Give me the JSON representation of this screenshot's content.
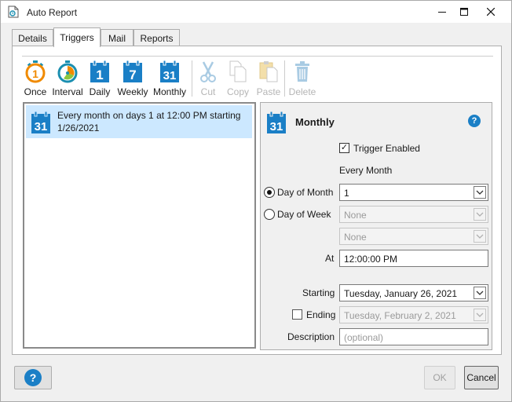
{
  "window": {
    "title": "Auto Report"
  },
  "tabs": [
    {
      "label": "Details"
    },
    {
      "label": "Triggers"
    },
    {
      "label": "Mail"
    },
    {
      "label": "Reports"
    }
  ],
  "toolbar": {
    "once": {
      "label": "Once",
      "icon": "stopwatch-once-icon",
      "icon_text": "1"
    },
    "interval": {
      "label": "Interval",
      "icon": "stopwatch-interval-icon"
    },
    "daily": {
      "label": "Daily",
      "icon": "calendar-daily-icon",
      "icon_text": "1"
    },
    "weekly": {
      "label": "Weekly",
      "icon": "calendar-weekly-icon",
      "icon_text": "7"
    },
    "monthly": {
      "label": "Monthly",
      "icon": "calendar-monthly-icon",
      "icon_text": "31"
    },
    "cut": {
      "label": "Cut",
      "icon": "scissors-icon"
    },
    "copy": {
      "label": "Copy",
      "icon": "copy-icon"
    },
    "paste": {
      "label": "Paste",
      "icon": "paste-icon"
    },
    "delete": {
      "label": "Delete",
      "icon": "trash-icon"
    }
  },
  "trigger_list": [
    {
      "text": "Every month on days 1 at 12:00 PM starting 1/26/2021",
      "icon_text": "31"
    }
  ],
  "detail": {
    "title": "Monthly",
    "icon_text": "31",
    "trigger_enabled_label": "Trigger Enabled",
    "trigger_enabled": true,
    "every_month_label": "Every Month",
    "day_of_month_label": "Day of Month",
    "day_of_month_value": "1",
    "day_of_week_label": "Day of Week",
    "day_of_week_value": "None",
    "day_of_week_value2": "None",
    "at_label": "At",
    "at_value": "12:00:00 PM",
    "starting_label": "Starting",
    "starting_value": "Tuesday, January 26, 2021",
    "ending_label": "Ending",
    "ending_value": "Tuesday, February 2, 2021",
    "ending_enabled": false,
    "description_label": "Description",
    "description_placeholder": "(optional)",
    "help_symbol": "?"
  },
  "footer": {
    "help_symbol": "?",
    "ok_label": "OK",
    "cancel_label": "Cancel"
  },
  "colors": {
    "accent_blue": "#1a7fc6",
    "once_orange": "#f08a00",
    "interval_teal": "#1b8fb0",
    "selection": "#cce8ff"
  }
}
